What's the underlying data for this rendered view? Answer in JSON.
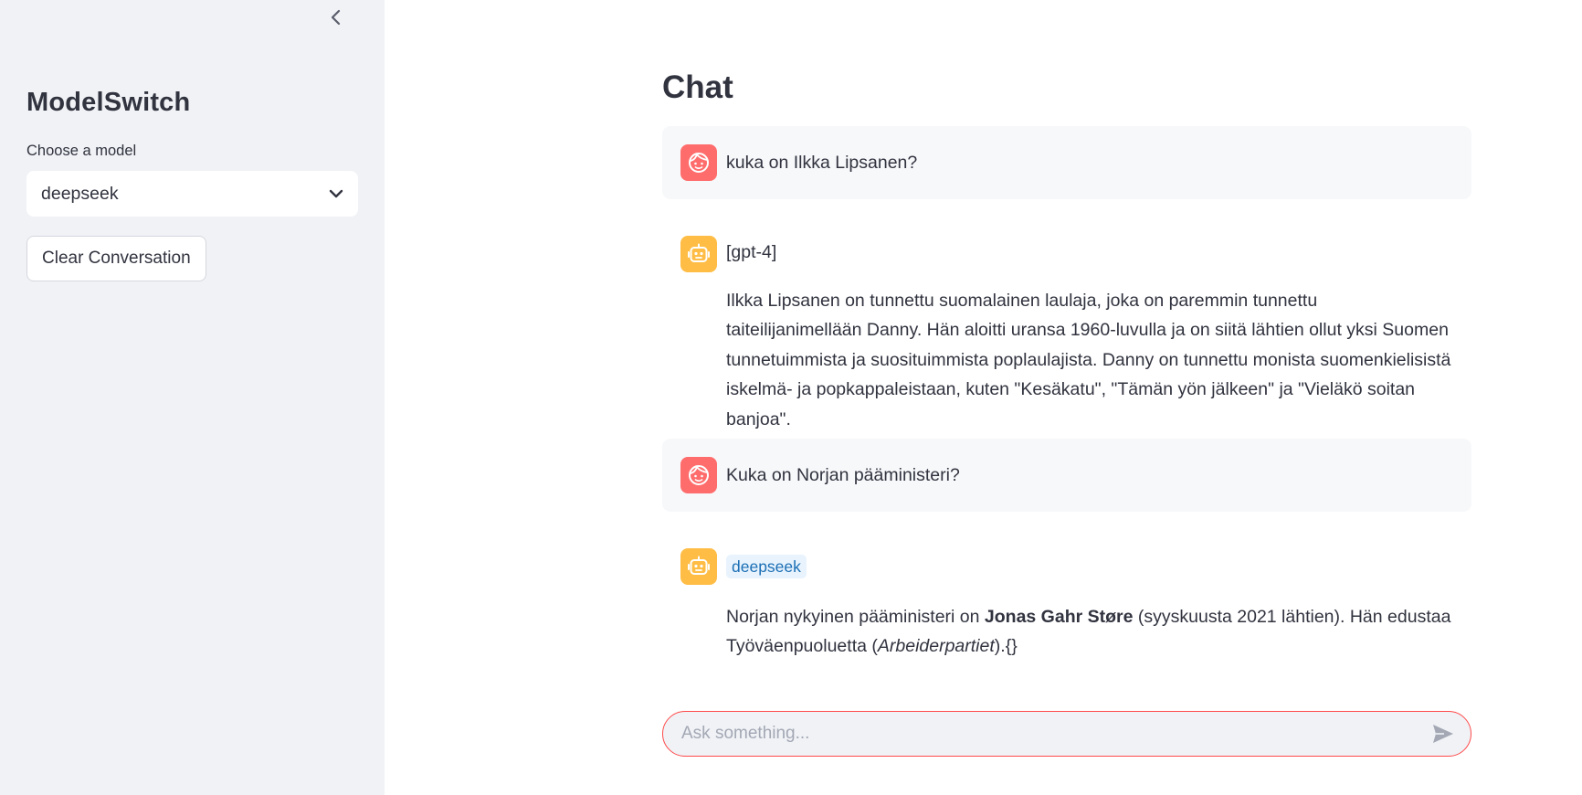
{
  "sidebar": {
    "title": "ModelSwitch",
    "model_label": "Choose a model",
    "model_selected": "deepseek",
    "clear_label": "Clear Conversation"
  },
  "main": {
    "title": "Chat",
    "messages": [
      {
        "role": "user",
        "text": "kuka on Ilkka Lipsanen?"
      },
      {
        "role": "assistant",
        "model": "[gpt-4]",
        "text": "Ilkka Lipsanen on tunnettu suomalainen laulaja, joka on paremmin tunnettu taiteilijanimellään Danny. Hän aloitti uransa 1960-luvulla ja on siitä lähtien ollut yksi Suomen tunnetuimmista ja suosituimmista poplaulajista. Danny on tunnettu monista suomenkielisistä iskelmä- ja popkappaleistaan, kuten \"Kesäkatu\", \"Tämän yön jälkeen\" ja \"Vieläkö soitan banjoa\"."
      },
      {
        "role": "user",
        "text": "Kuka on Norjan pääministeri?"
      },
      {
        "role": "assistant",
        "model": "deepseek",
        "text_before": "Norjan nykyinen pääministeri on ",
        "text_bold": "Jonas Gahr Støre",
        "text_middle": " (syyskuusta 2021 lähtien). Hän edustaa Työväenpuoluetta (",
        "text_italic": "Arbeiderpartiet",
        "text_after": ").{}"
      }
    ]
  },
  "input": {
    "placeholder": "Ask something..."
  },
  "colors": {
    "sidebar_bg": "#f0f2f6",
    "user_avatar": "#ff6c6c",
    "bot_avatar": "#ffbd45",
    "accent": "#ff4b4b",
    "tag_bg": "#e8f3fd",
    "tag_text": "#1c6fb5"
  },
  "icons": {
    "collapse": "chevron-left-icon",
    "select": "chevron-down-icon",
    "user": "face-icon",
    "assistant": "robot-icon",
    "send": "send-icon"
  }
}
